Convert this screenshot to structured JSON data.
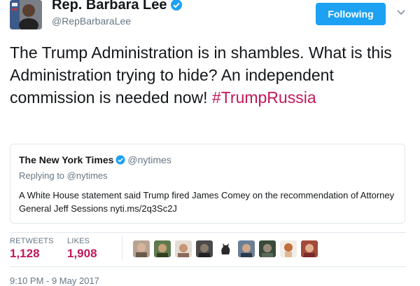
{
  "profile": {
    "display_name": "Rep. Barbara Lee",
    "handle": "@RepBarbaraLee",
    "verified": true
  },
  "follow_button": {
    "label": "Following"
  },
  "tweet": {
    "text": "The Trump Administration is in shambles. What is this Administration trying to hide? An independent commission is needed now! ",
    "hashtag": "#TrumpRussia"
  },
  "quoted_tweet": {
    "name": "The New York Times",
    "verified": true,
    "handle": "@nytimes",
    "reply_context": "Replying to @nytimes",
    "text": "A White House statement said Trump fired James Comey on the recommendation of Attorney General Jeff Sessions nyti.ms/2q3Sc2J"
  },
  "stats": {
    "retweets_label": "RETWEETS",
    "retweets_count": "1,128",
    "likes_label": "LIKES",
    "likes_count": "1,908"
  },
  "liker_avatars": [
    "avatar",
    "avatar",
    "avatar",
    "avatar",
    "cat-icon",
    "avatar",
    "avatar",
    "avatar",
    "avatar"
  ],
  "timestamp": "9:10 PM - 9 May 2017",
  "colors": {
    "accent_blue": "#1da1f2",
    "hashtag_color": "#c2185b",
    "secondary_text": "#657786",
    "border": "#e1e8ed"
  },
  "icons": {
    "verified": "verified-badge-icon",
    "menu": "chevron-down-icon"
  }
}
